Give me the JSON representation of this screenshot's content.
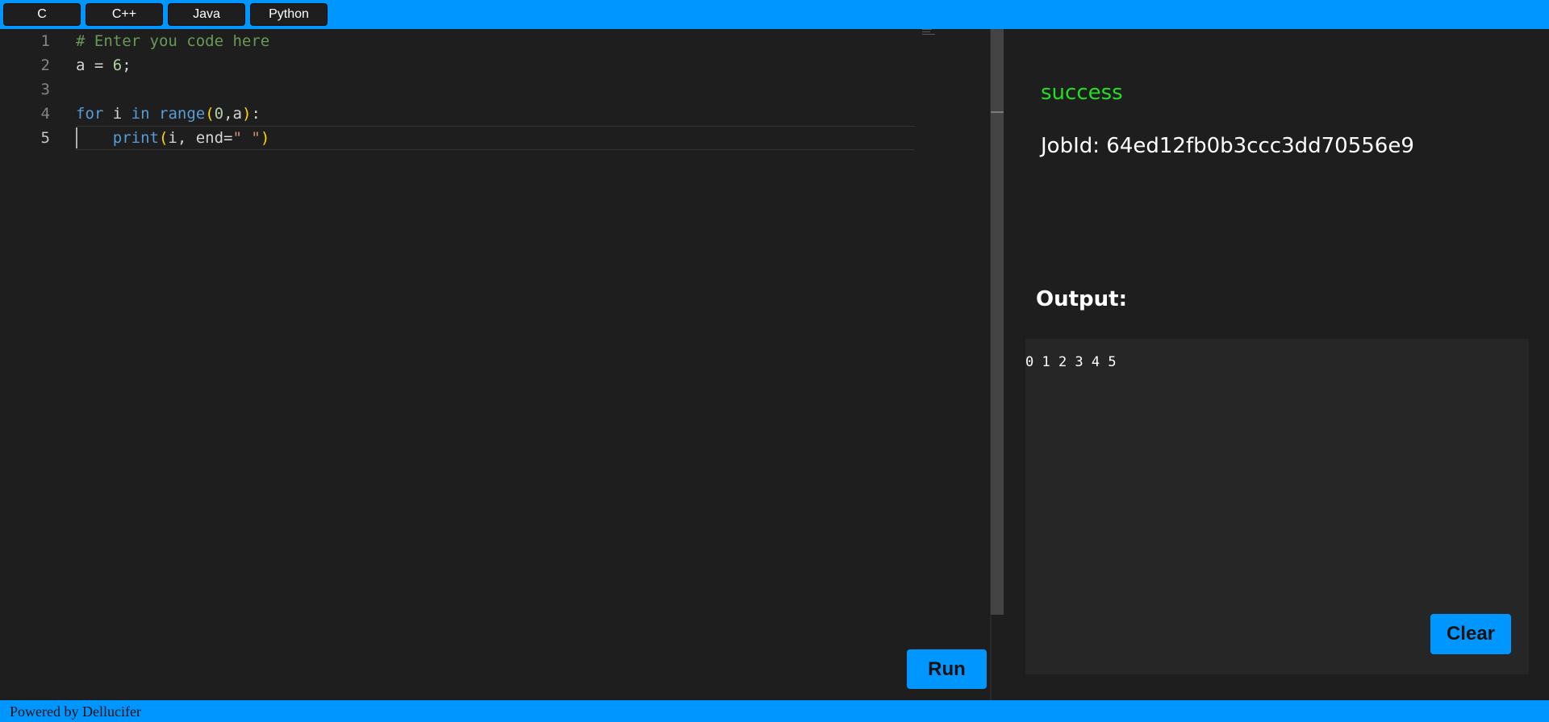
{
  "colors": {
    "accent": "#0096ff",
    "background": "#1e1e1e",
    "success": "#22dd22",
    "output_background": "#262626"
  },
  "language_tabs": [
    "C",
    "C++",
    "Java",
    "Python"
  ],
  "editor": {
    "line_numbers": [
      "1",
      "2",
      "3",
      "4",
      "5"
    ],
    "active_line": 5,
    "lines": [
      "# Enter you code here",
      "a = 6;",
      "",
      "for i in range(0,a):",
      "    print(i, end=\" \")"
    ]
  },
  "run_button": "Run",
  "result": {
    "status": "success",
    "job_id_label": "JobId: 64ed12fb0b3ccc3dd70556e9"
  },
  "output": {
    "title": "Output:",
    "text": "0 1 2 3 4 5"
  },
  "clear_button": "Clear",
  "footer": "Powered by Dellucifer"
}
